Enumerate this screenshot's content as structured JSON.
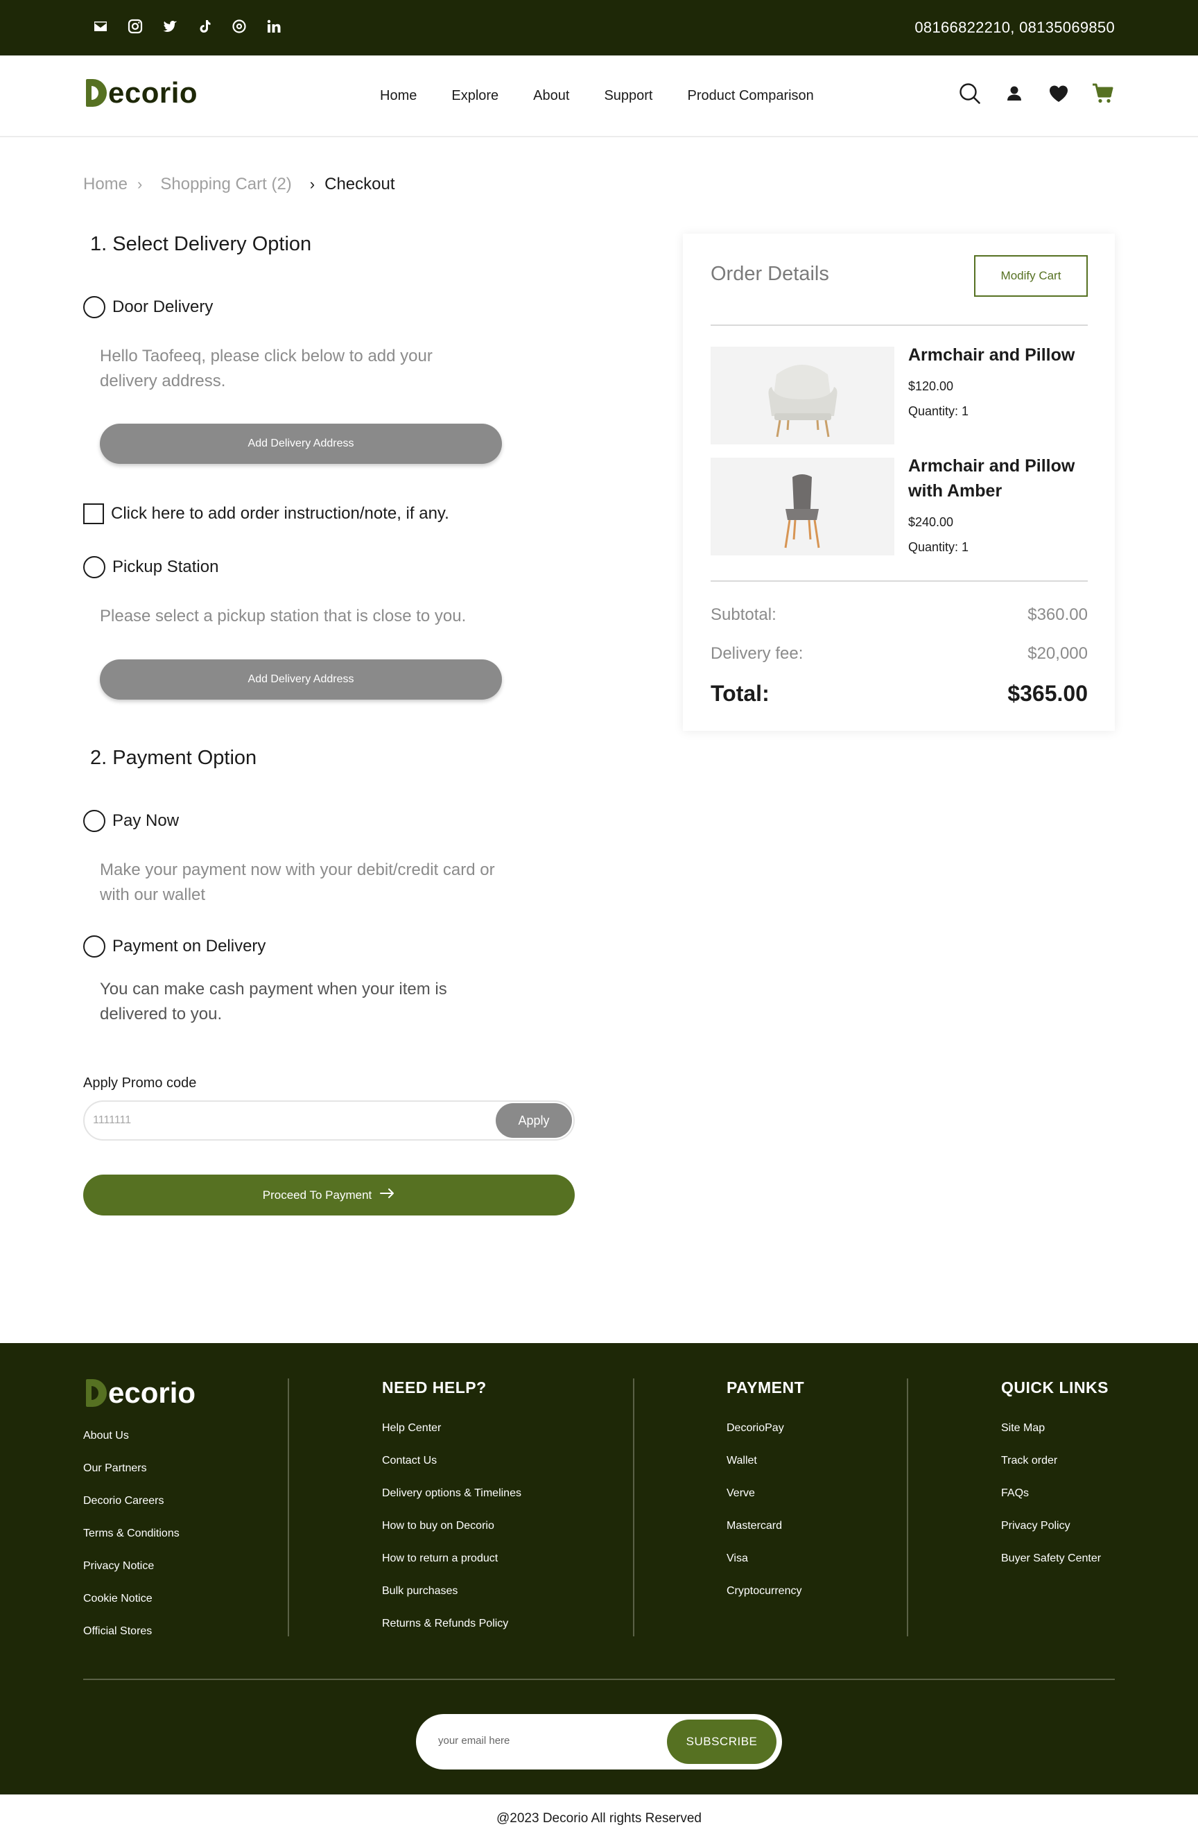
{
  "topbar": {
    "phones": "08166822210,  08135069850",
    "socials": [
      "mail-icon",
      "instagram-icon",
      "twitter-icon",
      "tiktok-icon",
      "threads-icon",
      "linkedin-icon"
    ]
  },
  "header": {
    "logo": "ecorio",
    "nav": [
      "Home",
      "Explore",
      "About",
      "Support",
      "Product Comparison"
    ],
    "icons": [
      "search-icon",
      "user-icon",
      "heart-icon",
      "cart-icon"
    ]
  },
  "breadcrumb": {
    "home": "Home",
    "cart": "Shopping Cart (2)",
    "current": "Checkout"
  },
  "delivery": {
    "title": "1.  Select Delivery Option",
    "door_label": "Door Delivery",
    "door_help": "Hello Taofeeq, please click below to add your delivery address.",
    "door_button": "Add Delivery Address",
    "note_label": "Click here to add order instruction/note, if any.",
    "pickup_label": "Pickup Station",
    "pickup_help": "Please select a pickup station that is close to you.",
    "pickup_button": "Add Delivery Address"
  },
  "payment": {
    "title": "2.  Payment Option",
    "paynow_label": "Pay Now",
    "paynow_help": "Make your payment now with your debit/credit card or with our wallet",
    "pod_label": "Payment on Delivery",
    "pod_help": "You can make cash payment when your item is delivered to you."
  },
  "promo": {
    "label": "Apply Promo code",
    "placeholder": "1111111",
    "apply": "Apply"
  },
  "proceed": "Proceed To Payment",
  "order": {
    "title": "Order Details",
    "modify": "Modify Cart",
    "items": [
      {
        "name": "Armchair and Pillow",
        "price": "$120.00",
        "qty": "Quantity: 1"
      },
      {
        "name": "Armchair and Pillow with Amber",
        "price": "$240.00",
        "qty": "Quantity: 1"
      }
    ],
    "subtotal_label": "Subtotal:",
    "subtotal": "$360.00",
    "delivery_label": "Delivery fee:",
    "delivery": "$20,000",
    "total_label": "Total:",
    "total": "$365.00"
  },
  "footer": {
    "logo": "ecorio",
    "about": [
      "About Us",
      "Our Partners",
      "Decorio Careers",
      "Terms & Conditions",
      "Privacy Notice",
      "Cookie Notice",
      "Official Stores"
    ],
    "help_title": "NEED HELP?",
    "help": [
      "Help Center",
      "Contact Us",
      "Delivery options & Timelines",
      "How to buy on Decorio",
      "How to return a product",
      "Bulk purchases",
      "Returns & Refunds Policy"
    ],
    "payment_title": "PAYMENT",
    "payment": [
      "DecorioPay",
      "Wallet",
      "Verve",
      "Mastercard",
      "Visa",
      "Cryptocurrency"
    ],
    "links_title": "QUICK LINKS",
    "links": [
      "Site Map",
      "Track order",
      "FAQs",
      "Privacy Policy",
      "Buyer Safety Center"
    ],
    "email_placeholder": "your email here",
    "subscribe": "SUBSCRIBE",
    "copyright": "@2023 Decorio All rights Reserved"
  },
  "colors": {
    "brand_dark": "#1e2807",
    "accent": "#567122",
    "grey_button": "#8a8a8a"
  }
}
